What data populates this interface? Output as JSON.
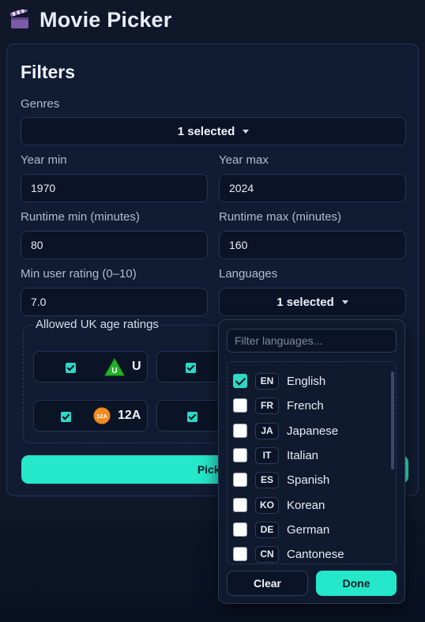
{
  "app": {
    "icon": "clapperboard-icon",
    "title": "Movie Picker"
  },
  "filters": {
    "title": "Filters",
    "genres": {
      "label": "Genres",
      "value": "1 selected"
    },
    "year_min": {
      "label": "Year min",
      "value": "1970"
    },
    "year_max": {
      "label": "Year max",
      "value": "2024"
    },
    "runtime_min": {
      "label": "Runtime min (minutes)",
      "value": "80"
    },
    "runtime_max": {
      "label": "Runtime max (minutes)",
      "value": "160"
    },
    "min_rating": {
      "label": "Min user rating (0–10)",
      "value": "7.0"
    },
    "languages": {
      "label": "Languages",
      "value": "1 selected"
    },
    "age_ratings": {
      "legend": "Allowed UK age ratings",
      "items": [
        {
          "label": "U",
          "badge": "U",
          "checked": true
        },
        {
          "label": "",
          "checked": true
        },
        {
          "label": "12A",
          "badge": "12A",
          "checked": true
        },
        {
          "label": "",
          "checked": true
        }
      ]
    },
    "pick_button": "Pick M"
  },
  "language_dropdown": {
    "filter_placeholder": "Filter languages...",
    "options": [
      {
        "code": "EN",
        "name": "English",
        "checked": true
      },
      {
        "code": "FR",
        "name": "French",
        "checked": false
      },
      {
        "code": "JA",
        "name": "Japanese",
        "checked": false
      },
      {
        "code": "IT",
        "name": "Italian",
        "checked": false
      },
      {
        "code": "ES",
        "name": "Spanish",
        "checked": false
      },
      {
        "code": "KO",
        "name": "Korean",
        "checked": false
      },
      {
        "code": "DE",
        "name": "German",
        "checked": false
      },
      {
        "code": "CN",
        "name": "Cantonese",
        "checked": false
      }
    ],
    "clear_label": "Clear",
    "done_label": "Done"
  },
  "colors": {
    "accent": "#24e8c9",
    "background": "#0f1729",
    "panel": "#111c33",
    "u_rating": "#22b525",
    "rating_12a": "#f28a1e"
  }
}
